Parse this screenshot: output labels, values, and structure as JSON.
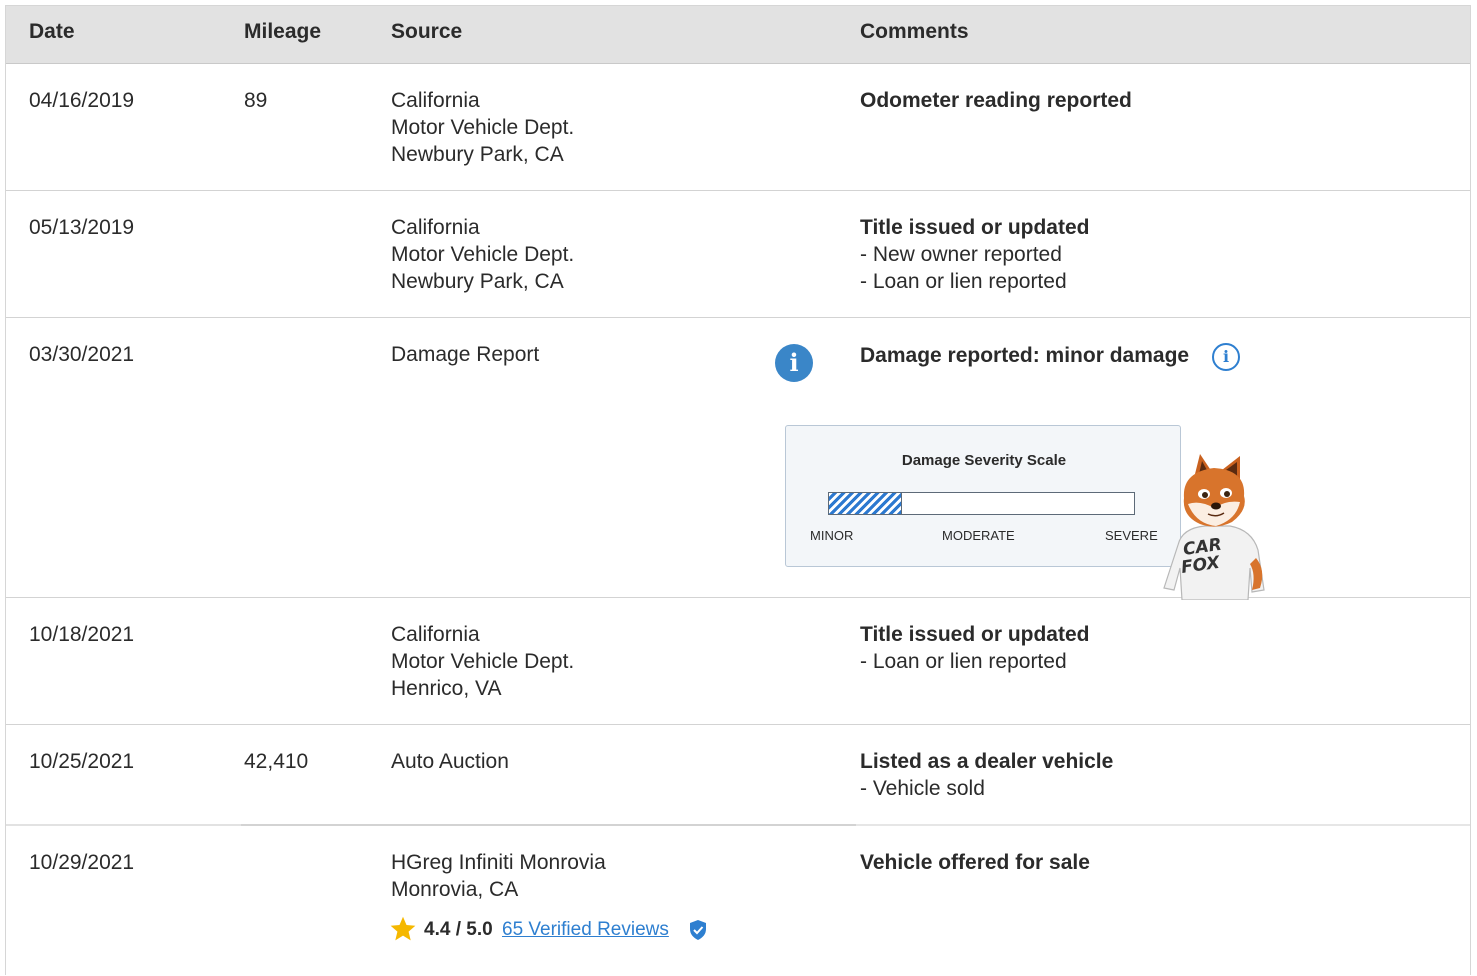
{
  "header": {
    "date": "Date",
    "mileage": "Mileage",
    "source": "Source",
    "comments": "Comments"
  },
  "rows": [
    {
      "date": "04/16/2019",
      "mileage": "89",
      "source": [
        "California",
        "Motor Vehicle Dept.",
        "Newbury Park, CA"
      ],
      "comment_title": "Odometer reading reported",
      "comment_items": []
    },
    {
      "date": "05/13/2019",
      "mileage": "",
      "source": [
        "California",
        "Motor Vehicle Dept.",
        "Newbury Park, CA"
      ],
      "comment_title": "Title issued or updated",
      "comment_items": [
        "New owner reported",
        "Loan or lien reported"
      ]
    },
    {
      "date": "03/30/2021",
      "mileage": "",
      "source": [
        "Damage Report"
      ],
      "comment_title": "Damage reported: minor damage",
      "comment_items": []
    },
    {
      "date": "10/18/2021",
      "mileage": "",
      "source": [
        "California",
        "Motor Vehicle Dept.",
        "Henrico, VA"
      ],
      "comment_title": "Title issued or updated",
      "comment_items": [
        "Loan or lien reported"
      ]
    },
    {
      "date": "10/25/2021",
      "mileage": "42,410",
      "source": [
        "Auto Auction"
      ],
      "comment_title": "Listed as a dealer vehicle",
      "comment_items": [
        "Vehicle sold"
      ]
    },
    {
      "date": "10/29/2021",
      "mileage": "",
      "source": [
        "HGreg Infiniti Monrovia",
        "Monrovia, CA"
      ],
      "comment_title": "Vehicle offered for sale",
      "comment_items": []
    }
  ],
  "severity": {
    "title": "Damage Severity Scale",
    "labels": {
      "minor": "MINOR",
      "moderate": "MODERATE",
      "severe": "SEVERE"
    },
    "level_fraction": 0.24,
    "fill_color": "#2c79d0"
  },
  "dealer_rating": {
    "score": "4.4 / 5.0",
    "reviews_link": "65 Verified Reviews",
    "star_color": "#f5b800",
    "link_color": "#2e7fd0"
  },
  "icons": {
    "damage_info": "info-icon",
    "comment_info": "info-outline-icon",
    "rating": "star-icon",
    "verified": "verified-shield-icon",
    "mascot": "carfox-mascot"
  },
  "mascot_shirt": {
    "line1": "CAR",
    "line2": "FOX"
  }
}
